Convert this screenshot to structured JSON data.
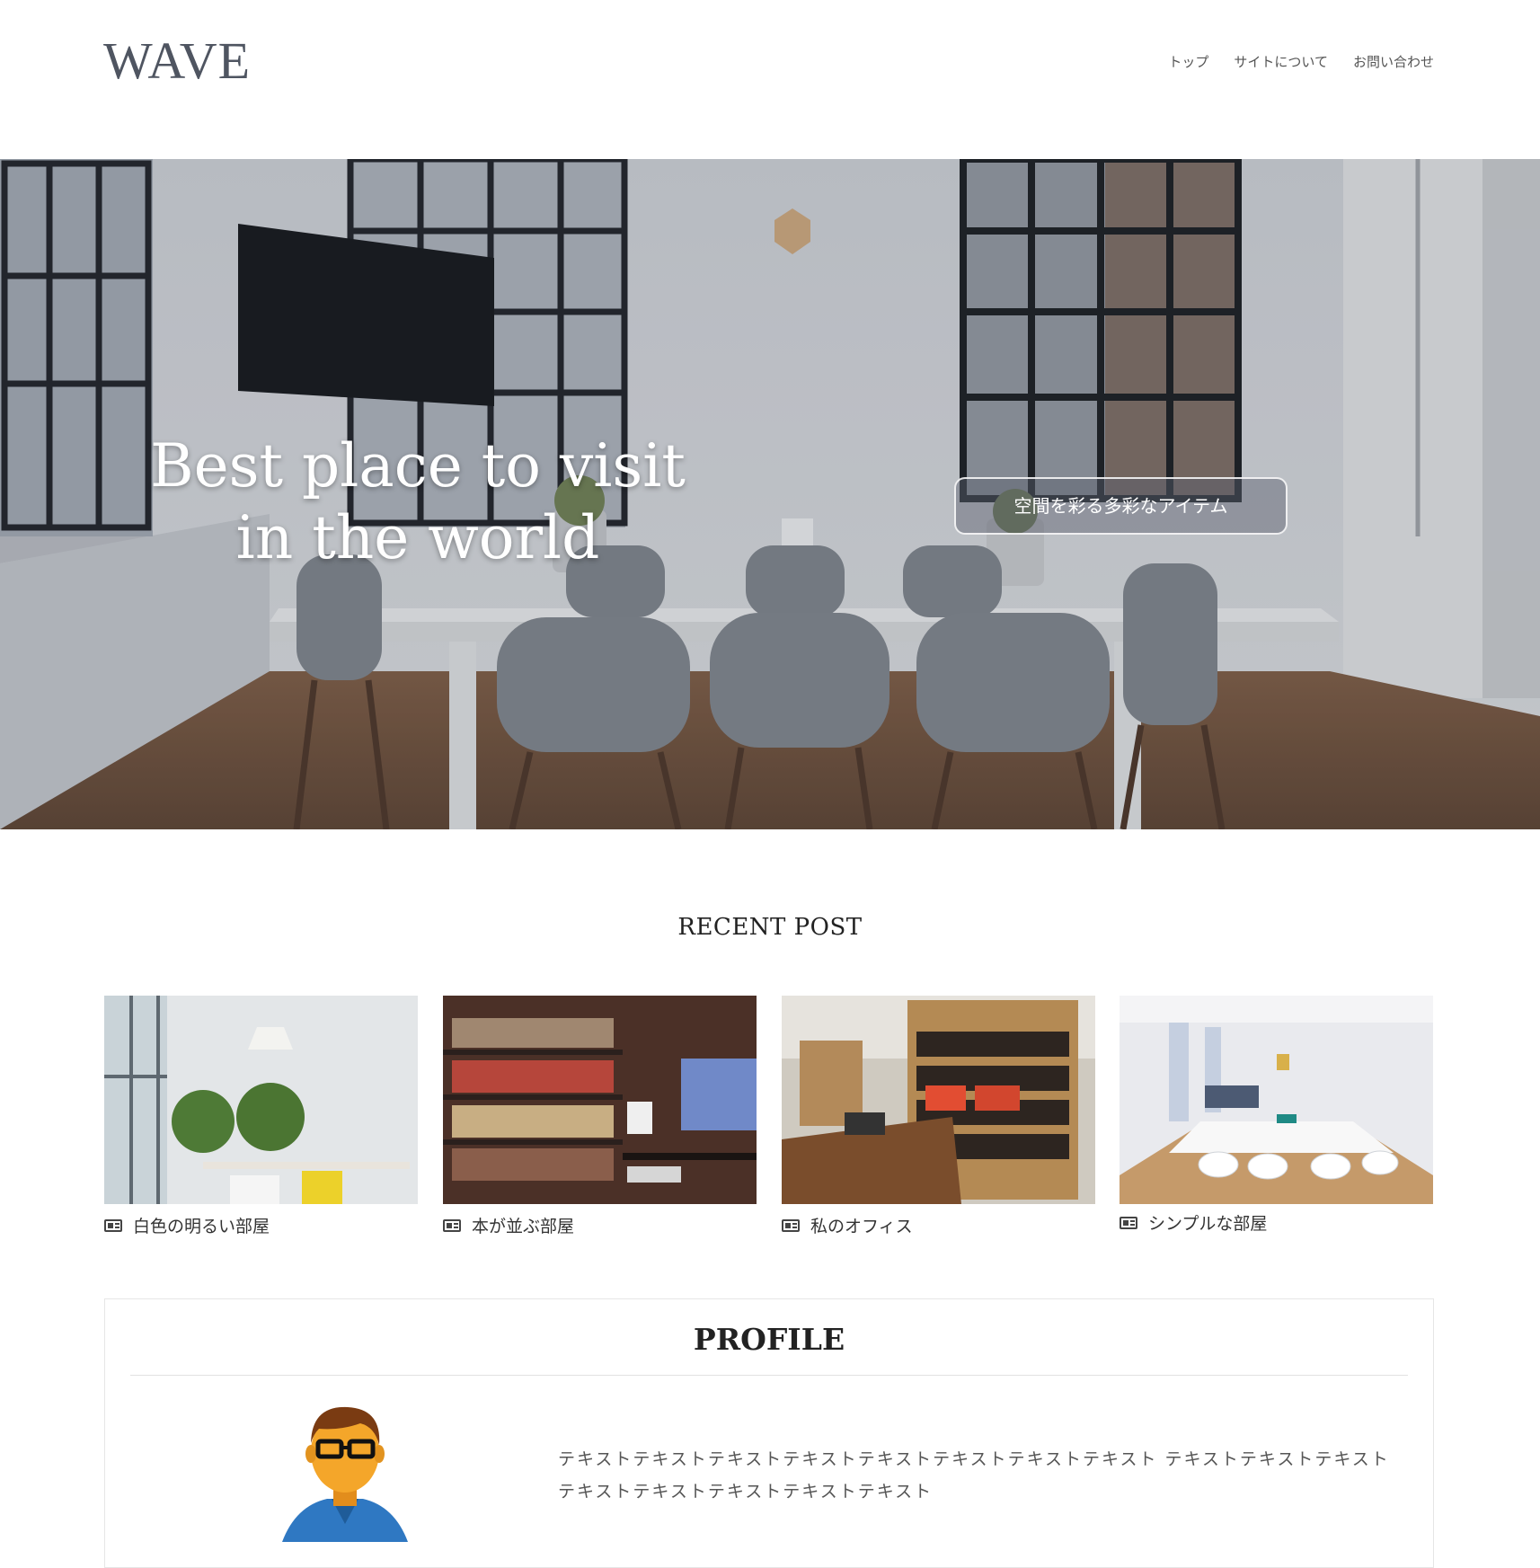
{
  "header": {
    "logo": "WAVE",
    "nav": [
      "トップ",
      "サイトについて",
      "お問い合わせ"
    ]
  },
  "hero": {
    "title_line1": "Best place to visit",
    "title_line2": "in the world",
    "tag_button": "空間を彩る多彩なアイテム"
  },
  "recent": {
    "title": "RECENT POST",
    "posts": [
      {
        "label": "白色の明るい部屋"
      },
      {
        "label": "本が並ぶ部屋"
      },
      {
        "label": "私のオフィス"
      },
      {
        "label": "シンプルな部屋"
      }
    ]
  },
  "profile": {
    "title": "PROFILE",
    "text": "テキストテキストテキストテキストテキストテキストテキストテキスト テキストテキストテキストテキストテキストテキストテキストテキスト"
  },
  "colors": {
    "logo": "#4f5561",
    "text": "#333333",
    "border": "#e6e6e6"
  }
}
